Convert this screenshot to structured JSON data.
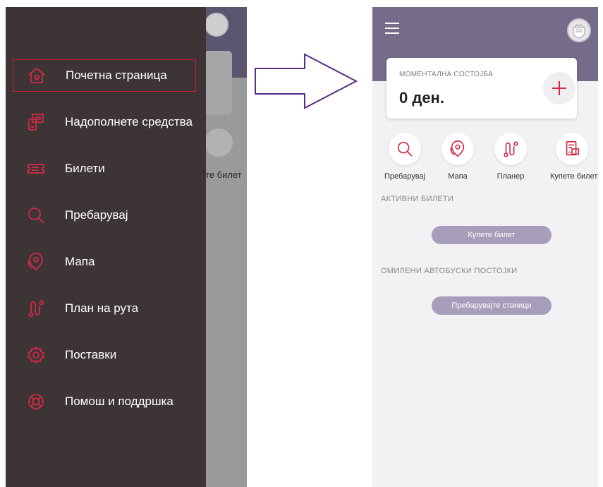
{
  "drawer": {
    "items": [
      {
        "label": "Почетна страница",
        "icon": "home-icon",
        "active": true
      },
      {
        "label": "Надополнете средства",
        "icon": "top-up-icon"
      },
      {
        "label": "Билети",
        "icon": "ticket-icon"
      },
      {
        "label": "Пребарувај",
        "icon": "search-icon"
      },
      {
        "label": "Мапа",
        "icon": "map-pin-icon"
      },
      {
        "label": "План на рута",
        "icon": "route-icon"
      },
      {
        "label": "Поставки",
        "icon": "gear-icon"
      },
      {
        "label": "Помош и поддршка",
        "icon": "lifebuoy-icon"
      }
    ],
    "background_partial_label": "те билет"
  },
  "home": {
    "balance_title": "МОМЕНТАЛНА СОСТОЈБА",
    "balance_value": "0 ден.",
    "quick_actions": [
      {
        "label": "Пребарувај",
        "icon": "search-icon"
      },
      {
        "label": "Мапа",
        "icon": "map-pin-icon"
      },
      {
        "label": "Планер",
        "icon": "route-icon"
      },
      {
        "label": "Купете билет",
        "icon": "buy-ticket-icon"
      }
    ],
    "active_tickets_title": "АКТИВНИ БИЛЕТИ",
    "buy_ticket_button": "Купете билет",
    "favorite_stops_title": "ОМИЛЕНИ АВТОБУСКИ ПОСТОЈКИ",
    "search_stations_button": "Пребарувајте станици"
  },
  "colors": {
    "accent": "#d22a45",
    "drawer_bg": "#3d3535",
    "header_bg": "#756c8a",
    "pill_button": "#a79ebb",
    "arrow": "#5b2a86"
  }
}
